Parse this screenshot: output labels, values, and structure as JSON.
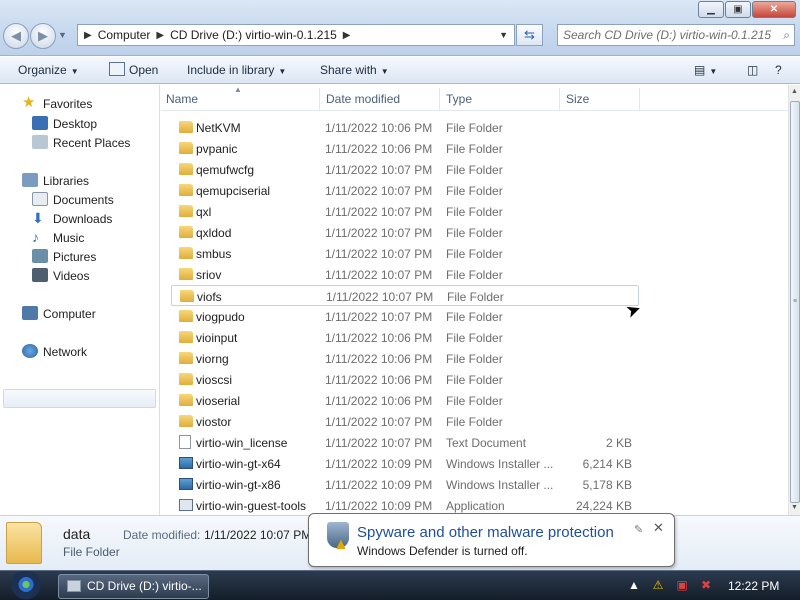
{
  "window": {
    "controls": {
      "minimize": "▁",
      "maximize": "▣",
      "close": "✕"
    }
  },
  "address": {
    "crumbs": [
      "Computer",
      "CD Drive (D:) virtio-win-0.1.215"
    ],
    "search_placeholder": "Search CD Drive (D:) virtio-win-0.1.215"
  },
  "toolbar": {
    "organize": "Organize",
    "open": "Open",
    "include_in_library": "Include in library",
    "share_with": "Share with"
  },
  "nav": {
    "favorites": "Favorites",
    "desktop": "Desktop",
    "recent_places": "Recent Places",
    "libraries": "Libraries",
    "documents": "Documents",
    "downloads": "Downloads",
    "music": "Music",
    "pictures": "Pictures",
    "videos": "Videos",
    "computer": "Computer",
    "network": "Network"
  },
  "columns": {
    "name": "Name",
    "date_modified": "Date modified",
    "type": "Type",
    "size": "Size"
  },
  "files": [
    {
      "name": "NetKVM",
      "date": "1/11/2022 10:06 PM",
      "type": "File Folder",
      "size": "",
      "icon": "folder"
    },
    {
      "name": "pvpanic",
      "date": "1/11/2022 10:06 PM",
      "type": "File Folder",
      "size": "",
      "icon": "folder"
    },
    {
      "name": "qemufwcfg",
      "date": "1/11/2022 10:07 PM",
      "type": "File Folder",
      "size": "",
      "icon": "folder"
    },
    {
      "name": "qemupciserial",
      "date": "1/11/2022 10:07 PM",
      "type": "File Folder",
      "size": "",
      "icon": "folder"
    },
    {
      "name": "qxl",
      "date": "1/11/2022 10:07 PM",
      "type": "File Folder",
      "size": "",
      "icon": "folder"
    },
    {
      "name": "qxldod",
      "date": "1/11/2022 10:07 PM",
      "type": "File Folder",
      "size": "",
      "icon": "folder"
    },
    {
      "name": "smbus",
      "date": "1/11/2022 10:07 PM",
      "type": "File Folder",
      "size": "",
      "icon": "folder"
    },
    {
      "name": "sriov",
      "date": "1/11/2022 10:07 PM",
      "type": "File Folder",
      "size": "",
      "icon": "folder"
    },
    {
      "name": "viofs",
      "date": "1/11/2022 10:07 PM",
      "type": "File Folder",
      "size": "",
      "icon": "folder"
    },
    {
      "name": "viogpudo",
      "date": "1/11/2022 10:07 PM",
      "type": "File Folder",
      "size": "",
      "icon": "folder"
    },
    {
      "name": "vioinput",
      "date": "1/11/2022 10:06 PM",
      "type": "File Folder",
      "size": "",
      "icon": "folder"
    },
    {
      "name": "viorng",
      "date": "1/11/2022 10:06 PM",
      "type": "File Folder",
      "size": "",
      "icon": "folder"
    },
    {
      "name": "vioscsi",
      "date": "1/11/2022 10:06 PM",
      "type": "File Folder",
      "size": "",
      "icon": "folder"
    },
    {
      "name": "vioserial",
      "date": "1/11/2022 10:06 PM",
      "type": "File Folder",
      "size": "",
      "icon": "folder"
    },
    {
      "name": "viostor",
      "date": "1/11/2022 10:07 PM",
      "type": "File Folder",
      "size": "",
      "icon": "folder"
    },
    {
      "name": "virtio-win_license",
      "date": "1/11/2022 10:07 PM",
      "type": "Text Document",
      "size": "2 KB",
      "icon": "txt"
    },
    {
      "name": "virtio-win-gt-x64",
      "date": "1/11/2022 10:09 PM",
      "type": "Windows Installer ...",
      "size": "6,214 KB",
      "icon": "msi"
    },
    {
      "name": "virtio-win-gt-x86",
      "date": "1/11/2022 10:09 PM",
      "type": "Windows Installer ...",
      "size": "5,178 KB",
      "icon": "msi"
    },
    {
      "name": "virtio-win-guest-tools",
      "date": "1/11/2022 10:09 PM",
      "type": "Application",
      "size": "24,224 KB",
      "icon": "app"
    }
  ],
  "selected_file": "viofs",
  "details": {
    "name": "data",
    "type": "File Folder",
    "date_label": "Date modified:",
    "date_value": "1/11/2022 10:07 PM"
  },
  "balloon": {
    "title": "Spyware and other malware protection",
    "body": "Windows Defender is turned off."
  },
  "taskbar": {
    "window_button": "CD Drive (D:) virtio-...",
    "clock": "12:22 PM"
  }
}
